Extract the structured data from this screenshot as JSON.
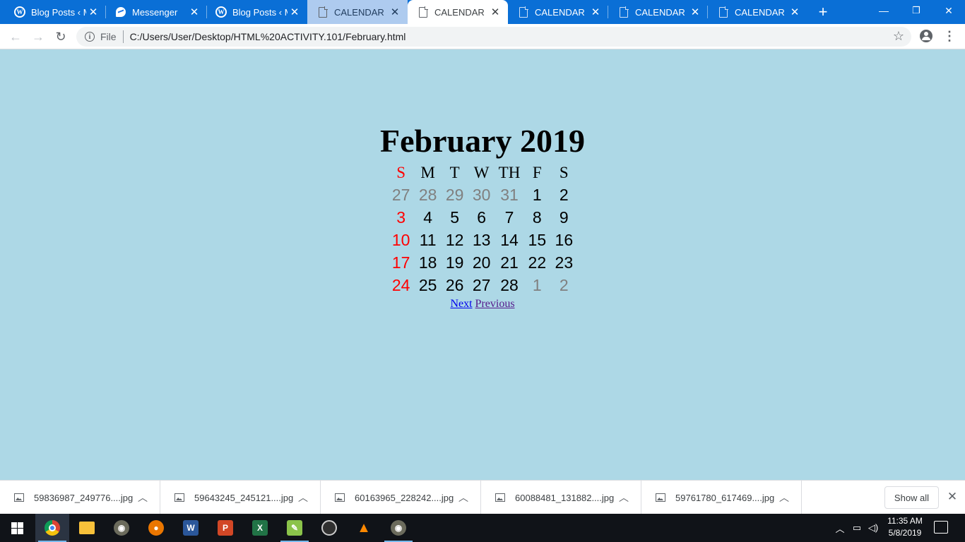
{
  "tabs": [
    {
      "title": "Blog Posts ‹ M",
      "icon": "wordpress-icon"
    },
    {
      "title": "Messenger",
      "icon": "messenger-icon"
    },
    {
      "title": "Blog Posts ‹ M",
      "icon": "wordpress-icon"
    },
    {
      "title": "CALENDAR",
      "icon": "document-icon"
    },
    {
      "title": "CALENDAR",
      "icon": "document-icon"
    },
    {
      "title": "CALENDAR",
      "icon": "document-icon"
    },
    {
      "title": "CALENDAR",
      "icon": "document-icon"
    },
    {
      "title": "CALENDAR",
      "icon": "document-icon"
    }
  ],
  "window_controls": {
    "minimize": "—",
    "restore": "❐",
    "close": "✕"
  },
  "addressbar": {
    "scheme_chip": "File",
    "url": "C:/Users/User/Desktop/HTML%20ACTIVITY.101/February.html"
  },
  "calendar": {
    "title": "February 2019",
    "weekdays": [
      "S",
      "M",
      "T",
      "W",
      "TH",
      "F",
      "S"
    ],
    "weeks": [
      [
        "27",
        "28",
        "29",
        "30",
        "31",
        "1",
        "2"
      ],
      [
        "3",
        "4",
        "5",
        "6",
        "7",
        "8",
        "9"
      ],
      [
        "10",
        "11",
        "12",
        "13",
        "14",
        "15",
        "16"
      ],
      [
        "17",
        "18",
        "19",
        "20",
        "21",
        "22",
        "23"
      ],
      [
        "24",
        "25",
        "26",
        "27",
        "28",
        "1",
        "2"
      ]
    ],
    "next_label": "Next",
    "previous_label": "Previous",
    "colors": {
      "background": "#add8e6",
      "sunday": "#ff0000",
      "other_month": "#808080"
    }
  },
  "downloads": {
    "items": [
      "59836987_249776....jpg",
      "59643245_245121....jpg",
      "60163965_228242....jpg",
      "60088481_131882....jpg",
      "59761780_617469....jpg"
    ],
    "show_all_label": "Show all"
  },
  "taskbar": {
    "apps": [
      "chrome-icon",
      "file-explorer-icon",
      "gimp-icon",
      "blender-icon",
      "word-icon",
      "powerpoint-icon",
      "excel-icon",
      "notepad-icon",
      "obs-icon",
      "vlc-icon",
      "gimp-icon"
    ],
    "time": "11:35 AM",
    "date": "5/8/2019"
  }
}
